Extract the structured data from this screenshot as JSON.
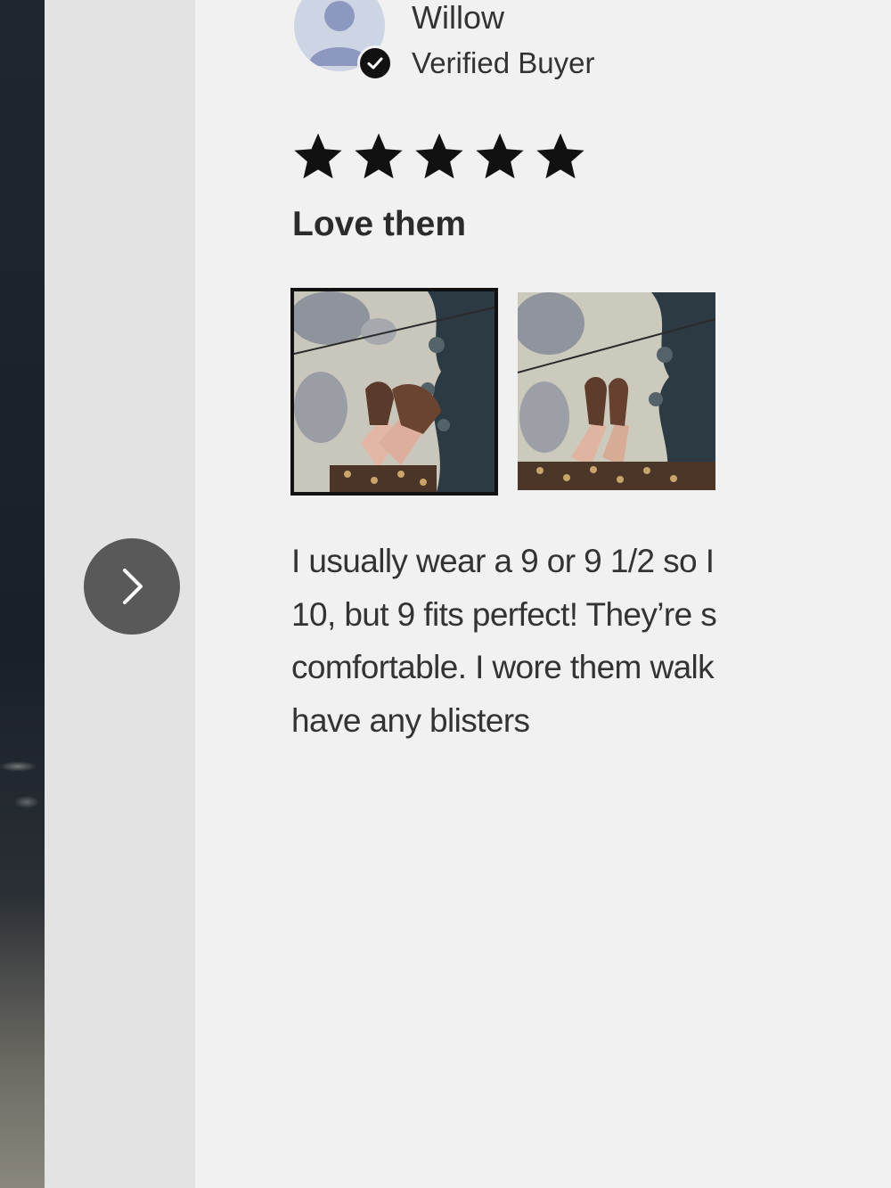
{
  "reviewer": {
    "name": "Willow",
    "status": "Verified Buyer"
  },
  "icons": {
    "avatar": "person-avatar-icon",
    "verified": "check-badge-icon",
    "rating": "star-icon",
    "next": "chevron-right-icon"
  },
  "review": {
    "rating": 5,
    "rating_max": 5,
    "title": "Love them",
    "body_lines": [
      "I usually wear a 9 or 9 1/2 so I",
      "10, but 9 fits perfect! They’re s",
      "comfortable. I wore them walk",
      "have any blisters"
    ]
  },
  "colors": {
    "panel_bg": "#f1f1f1",
    "gutter_bg": "#e3e3e3",
    "nav_button_bg": "#595959",
    "star_fill": "#111111",
    "avatar_bg": "#cdd4e4"
  }
}
